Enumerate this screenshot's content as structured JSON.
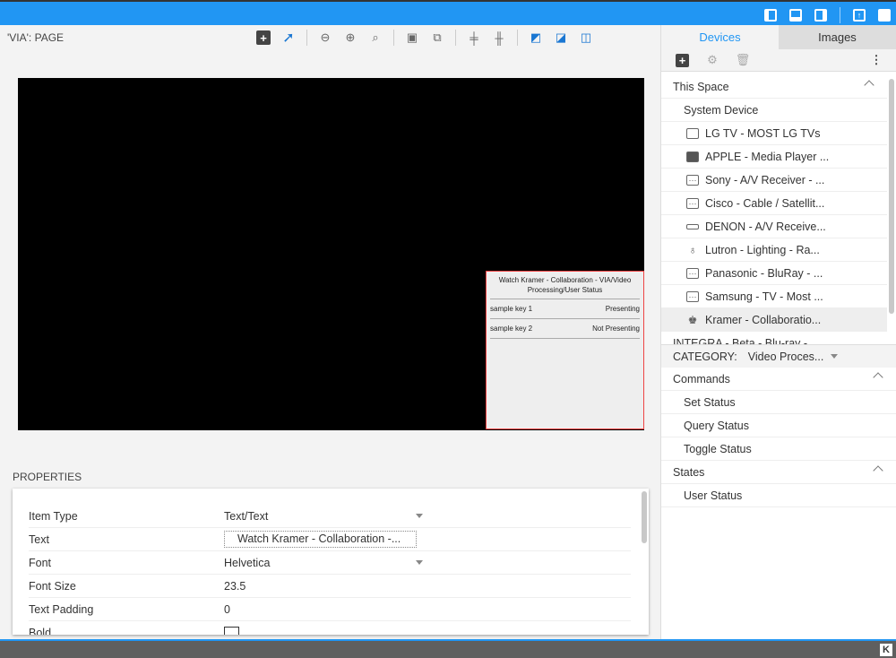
{
  "topbar": {
    "icons": [
      "layout-left-icon",
      "layout-bottom-icon",
      "layout-right-icon",
      "upload-icon",
      "save-icon"
    ]
  },
  "page": {
    "title": "'VIA': PAGE"
  },
  "toolbar": {
    "icons": [
      "add-icon",
      "pointer-icon",
      "zoom-out-icon",
      "zoom-in-icon",
      "zoom-fit-icon",
      "group-icon",
      "ungroup-icon",
      "align-horizontal-icon",
      "align-vertical-icon",
      "send-back-icon",
      "bring-front-icon",
      "grid-layout-icon"
    ]
  },
  "widget": {
    "title": "Watch Kramer - Collaboration - VIA/Video Processing/User Status",
    "rows": [
      {
        "key": "sample key 1",
        "value": "Presenting"
      },
      {
        "key": "sample key 2",
        "value": "Not Presenting"
      }
    ]
  },
  "properties": {
    "header": "PROPERTIES",
    "rows": [
      {
        "label": "Item Type",
        "value": "Text/Text"
      },
      {
        "label": "Text",
        "value": "Watch Kramer - Collaboration -..."
      },
      {
        "label": "Font",
        "value": "Helvetica"
      },
      {
        "label": "Font Size",
        "value": "23.5"
      },
      {
        "label": "Text Padding",
        "value": "0"
      },
      {
        "label": "Bold",
        "value": ""
      }
    ]
  },
  "tabs": {
    "devices": "Devices",
    "images": "Images"
  },
  "devices": {
    "section": "This Space",
    "system": "System Device",
    "items": [
      {
        "label": "LG TV - MOST LG TVs",
        "icon": "tv-icon"
      },
      {
        "label": "APPLE - Media Player ...",
        "icon": "media-player-icon"
      },
      {
        "label": "Sony - A/V Receiver - ...",
        "icon": "device-icon"
      },
      {
        "label": "Cisco - Cable / Satellit...",
        "icon": "device-icon"
      },
      {
        "label": "DENON - A/V Receive...",
        "icon": "receiver-icon"
      },
      {
        "label": "Lutron - Lighting - Ra...",
        "icon": "lightbulb-icon"
      },
      {
        "label": "Panasonic - BluRay - ...",
        "icon": "device-icon"
      },
      {
        "label": "Samsung - TV - Most ...",
        "icon": "device-icon"
      },
      {
        "label": "Kramer - Collaboratio...",
        "icon": "collaboration-icon"
      }
    ],
    "partial": "INTEGRA - Beta - Blu-ray - ..."
  },
  "category": {
    "label": "CATEGORY:",
    "value": "Video Proces..."
  },
  "commands": {
    "header": "Commands",
    "items": [
      "Set Status",
      "Query Status",
      "Toggle Status"
    ]
  },
  "states": {
    "header": "States",
    "items": [
      "User Status"
    ]
  },
  "footer": {
    "logo": "K"
  }
}
